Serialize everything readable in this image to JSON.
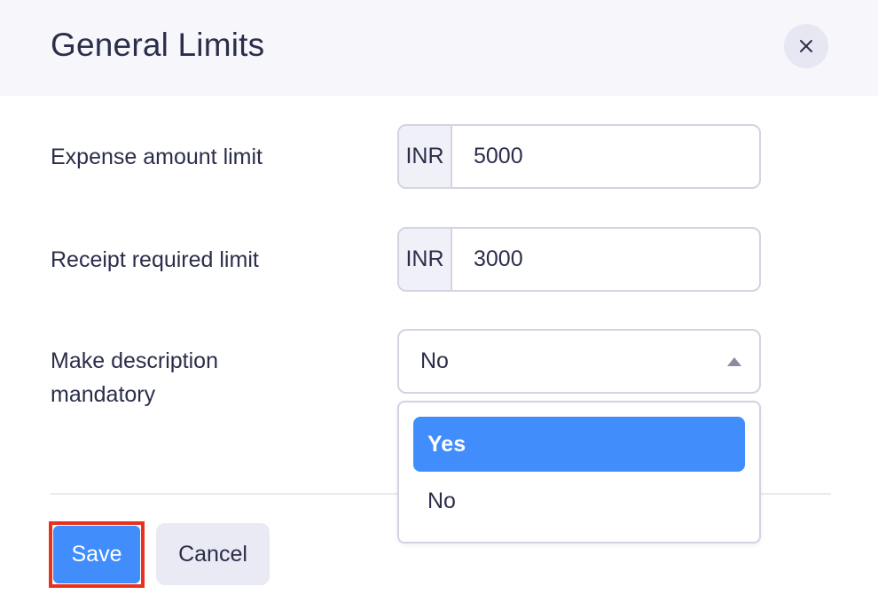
{
  "dialog": {
    "title": "General Limits"
  },
  "fields": {
    "expense_amount": {
      "label": "Expense amount limit",
      "currency": "INR",
      "value": "5000"
    },
    "receipt_required": {
      "label": "Receipt required limit",
      "currency": "INR",
      "value": "3000"
    },
    "description_mandatory": {
      "label_line1": "Make description",
      "label_line2": "mandatory",
      "selected": "No",
      "options": [
        "Yes",
        "No"
      ],
      "highlighted_option": "Yes"
    }
  },
  "footer": {
    "save_label": "Save",
    "cancel_label": "Cancel"
  },
  "icons": {
    "close": "close-icon",
    "caret": "caret-up-icon"
  },
  "colors": {
    "primary": "#408dfb",
    "highlight_outline": "#e8321f",
    "header_bg": "#f6f6fb",
    "text": "#2b2e4a"
  }
}
